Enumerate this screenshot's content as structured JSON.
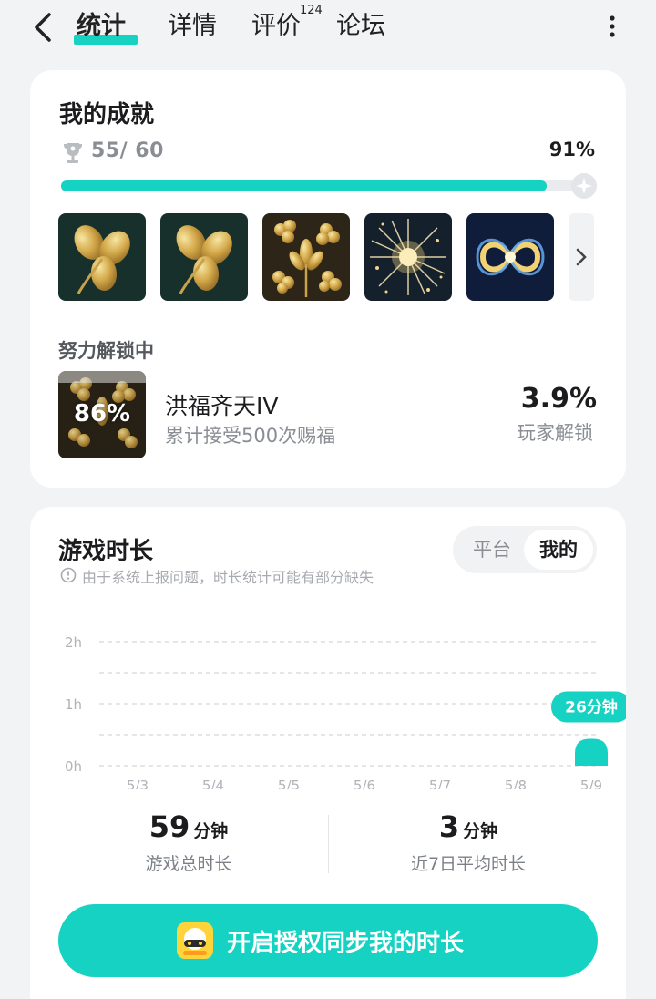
{
  "nav": {
    "tabs": [
      "统计",
      "详情",
      "评价",
      "论坛"
    ],
    "review_count": "124"
  },
  "achievements": {
    "title": "我的成就",
    "count_text": "55/ 60",
    "percent_text": "91%",
    "progress": 0.91,
    "badges": [
      {
        "name": "badge-golden-leaf-1",
        "art": "leaf"
      },
      {
        "name": "badge-golden-leaf-2",
        "art": "leaf"
      },
      {
        "name": "badge-golden-clover",
        "art": "clover"
      },
      {
        "name": "badge-sparkle-burst",
        "art": "sparkle"
      },
      {
        "name": "badge-infinity-glow",
        "art": "infinity"
      }
    ],
    "unlocking": {
      "title": "努力解锁中",
      "progress_text": "86%",
      "name": "洪福齐天IV",
      "description": "累计接受500次赐福",
      "rate": "3.9%",
      "rate_label": "玩家解锁"
    }
  },
  "playtime": {
    "title": "游戏时长",
    "toggle": {
      "platform": "平台",
      "mine": "我的"
    },
    "notice": "由于系统上报问题，时长统计可能有部分缺失",
    "total": {
      "value": "59",
      "unit": "分钟",
      "label": "游戏总时长"
    },
    "average": {
      "value": "3",
      "unit": "分钟",
      "label": "近7日平均时长"
    },
    "sync_button": "开启授权同步我的时长"
  },
  "chart_data": {
    "type": "bar",
    "categories": [
      "5/3",
      "5/4",
      "5/5",
      "5/6",
      "5/7",
      "5/8",
      "5/9"
    ],
    "values": [
      0,
      0,
      0,
      0,
      0,
      0,
      26
    ],
    "unit": "分钟",
    "yticks": [
      "0h",
      "1h",
      "2h"
    ],
    "ylim": [
      0,
      120
    ],
    "highlight": {
      "index": 6,
      "label": "26分钟"
    },
    "grid": true,
    "colors": {
      "bar": "#16d2c2",
      "grid": "#dcdee2"
    }
  },
  "colors": {
    "accent": "#16d2c2",
    "background": "#f2f3f5",
    "card": "#ffffff"
  }
}
